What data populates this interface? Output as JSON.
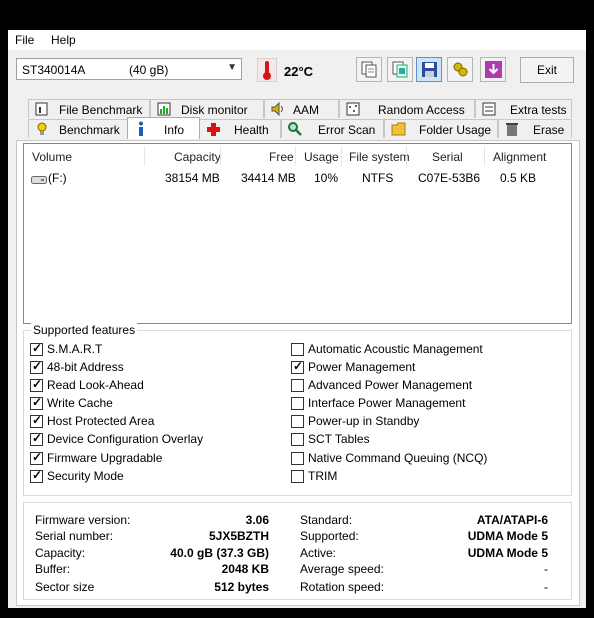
{
  "menu": {
    "file": "File",
    "help": "Help"
  },
  "toolbar": {
    "drive_model": "ST340014A",
    "drive_size": "(40 gB)",
    "temperature": "22°C",
    "exit_label": "Exit",
    "buttons": [
      "copy-info-icon",
      "copy-screenshot-icon",
      "save-icon",
      "options-icon",
      "download-icon"
    ]
  },
  "tabs_top": [
    "File Benchmark",
    "Disk monitor",
    "AAM",
    "Random Access",
    "Extra tests"
  ],
  "tabs_bottom": [
    "Benchmark",
    "Info",
    "Health",
    "Error Scan",
    "Folder Usage",
    "Erase"
  ],
  "selected_tab": "Info",
  "volume_table": {
    "headers": [
      "Volume",
      "Capacity",
      "Free",
      "Usage",
      "File system",
      "Serial",
      "Alignment"
    ],
    "rows": [
      [
        "(F:)",
        "38154 MB",
        "34414 MB",
        "10%",
        "NTFS",
        "C07E-53B6",
        "0.5 KB"
      ]
    ]
  },
  "features": {
    "title": "Supported features",
    "left": [
      {
        "label": "S.M.A.R.T",
        "checked": true
      },
      {
        "label": "48-bit Address",
        "checked": true
      },
      {
        "label": "Read Look-Ahead",
        "checked": true
      },
      {
        "label": "Write Cache",
        "checked": true
      },
      {
        "label": "Host Protected Area",
        "checked": true
      },
      {
        "label": "Device Configuration Overlay",
        "checked": true
      },
      {
        "label": "Firmware Upgradable",
        "checked": true
      },
      {
        "label": "Security Mode",
        "checked": true
      }
    ],
    "right": [
      {
        "label": "Automatic Acoustic Management",
        "checked": false
      },
      {
        "label": "Power Management",
        "checked": true
      },
      {
        "label": "Advanced Power Management",
        "checked": false
      },
      {
        "label": "Interface Power Management",
        "checked": false
      },
      {
        "label": "Power-up in Standby",
        "checked": false
      },
      {
        "label": "SCT Tables",
        "checked": false
      },
      {
        "label": "Native Command Queuing (NCQ)",
        "checked": false
      },
      {
        "label": "TRIM",
        "checked": false
      }
    ]
  },
  "info": {
    "left": [
      {
        "key": "Firmware version:",
        "value": "3.06"
      },
      {
        "key": "Serial number:",
        "value": "5JX5BZTH"
      },
      {
        "key": "Capacity:",
        "value": "40.0 gB (37.3 GB)"
      },
      {
        "key": "Buffer:",
        "value": "2048 KB"
      },
      {
        "key": "Sector size",
        "value": "512 bytes"
      }
    ],
    "right": [
      {
        "key": "Standard:",
        "value": "ATA/ATAPI-6"
      },
      {
        "key": "Supported:",
        "value": "UDMA Mode 5"
      },
      {
        "key": "Active:",
        "value": "UDMA Mode 5"
      },
      {
        "key": "Average speed:",
        "value": "-"
      },
      {
        "key": "Rotation speed:",
        "value": "-"
      }
    ]
  }
}
